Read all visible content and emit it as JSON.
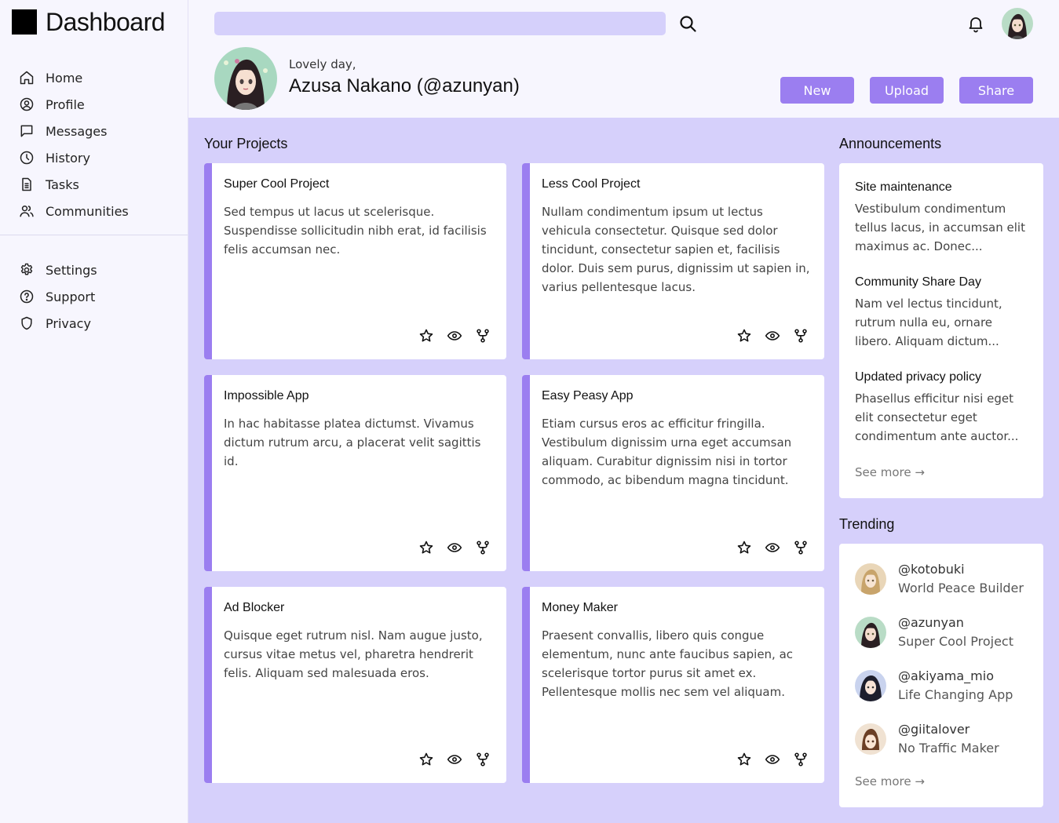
{
  "app": {
    "title": "Dashboard"
  },
  "sidebar": {
    "primary": [
      {
        "label": "Home",
        "icon": "home-icon"
      },
      {
        "label": "Profile",
        "icon": "user-circle-icon"
      },
      {
        "label": "Messages",
        "icon": "chat-icon"
      },
      {
        "label": "History",
        "icon": "clock-icon"
      },
      {
        "label": "Tasks",
        "icon": "document-icon"
      },
      {
        "label": "Communities",
        "icon": "users-icon"
      }
    ],
    "secondary": [
      {
        "label": "Settings",
        "icon": "gear-icon"
      },
      {
        "label": "Support",
        "icon": "question-icon"
      },
      {
        "label": "Privacy",
        "icon": "shield-icon"
      }
    ]
  },
  "header": {
    "search_placeholder": "",
    "greeting": "Lovely day,",
    "user_name": "Azusa Nakano (@azunyan)",
    "buttons": {
      "new": "New",
      "upload": "Upload",
      "share": "Share"
    }
  },
  "projects": {
    "title": "Your Projects",
    "items": [
      {
        "title": "Super Cool Project",
        "desc": "Sed tempus ut lacus ut scelerisque. Suspendisse sollicitudin nibh erat, id facilisis felis accumsan nec."
      },
      {
        "title": "Less Cool Project",
        "desc": "Nullam condimentum ipsum ut lectus vehicula consectetur. Quisque sed dolor tincidunt, consectetur sapien et, facilisis dolor. Duis sem purus, dignissim ut sapien in, varius pellentesque lacus."
      },
      {
        "title": "Impossible App",
        "desc": "In hac habitasse platea dictumst. Vivamus dictum rutrum arcu, a placerat velit sagittis id."
      },
      {
        "title": "Easy Peasy App",
        "desc": "Etiam cursus eros ac efficitur fringilla. Vestibulum dignissim urna eget accumsan aliquam. Curabitur dignissim nisi in tortor commodo, ac bibendum magna tincidunt."
      },
      {
        "title": "Ad Blocker",
        "desc": "Quisque eget rutrum nisl. Nam augue justo, cursus vitae metus vel, pharetra hendrerit felis. Aliquam sed malesuada eros."
      },
      {
        "title": "Money Maker",
        "desc": "Praesent convallis, libero quis congue elementum, nunc ante faucibus sapien, ac scelerisque tortor purus sit amet ex. Pellentesque mollis nec sem vel aliquam."
      }
    ]
  },
  "announcements": {
    "title": "Announcements",
    "items": [
      {
        "title": "Site maintenance",
        "body": "Vestibulum condimentum tellus lacus, in accumsan elit maximus ac. Donec..."
      },
      {
        "title": "Community Share Day",
        "body": "Nam vel lectus tincidunt, rutrum nulla eu, ornare libero. Aliquam dictum..."
      },
      {
        "title": "Updated privacy policy",
        "body": "Phasellus efficitur nisi eget elit consectetur eget condimentum ante auctor..."
      }
    ],
    "see_more": "See more →"
  },
  "trending": {
    "title": "Trending",
    "items": [
      {
        "handle": "@kotobuki",
        "project": "World Peace Builder"
      },
      {
        "handle": "@azunyan",
        "project": "Super Cool Project"
      },
      {
        "handle": "@akiyama_mio",
        "project": "Life Changing App"
      },
      {
        "handle": "@giitalover",
        "project": "No Traffic Maker"
      }
    ],
    "see_more": "See more →"
  },
  "colors": {
    "accent": "#9b7ef0",
    "main_bg": "#d6d0fb",
    "search_bg": "#d5d0fb",
    "page_bg": "#f7f6fe"
  }
}
